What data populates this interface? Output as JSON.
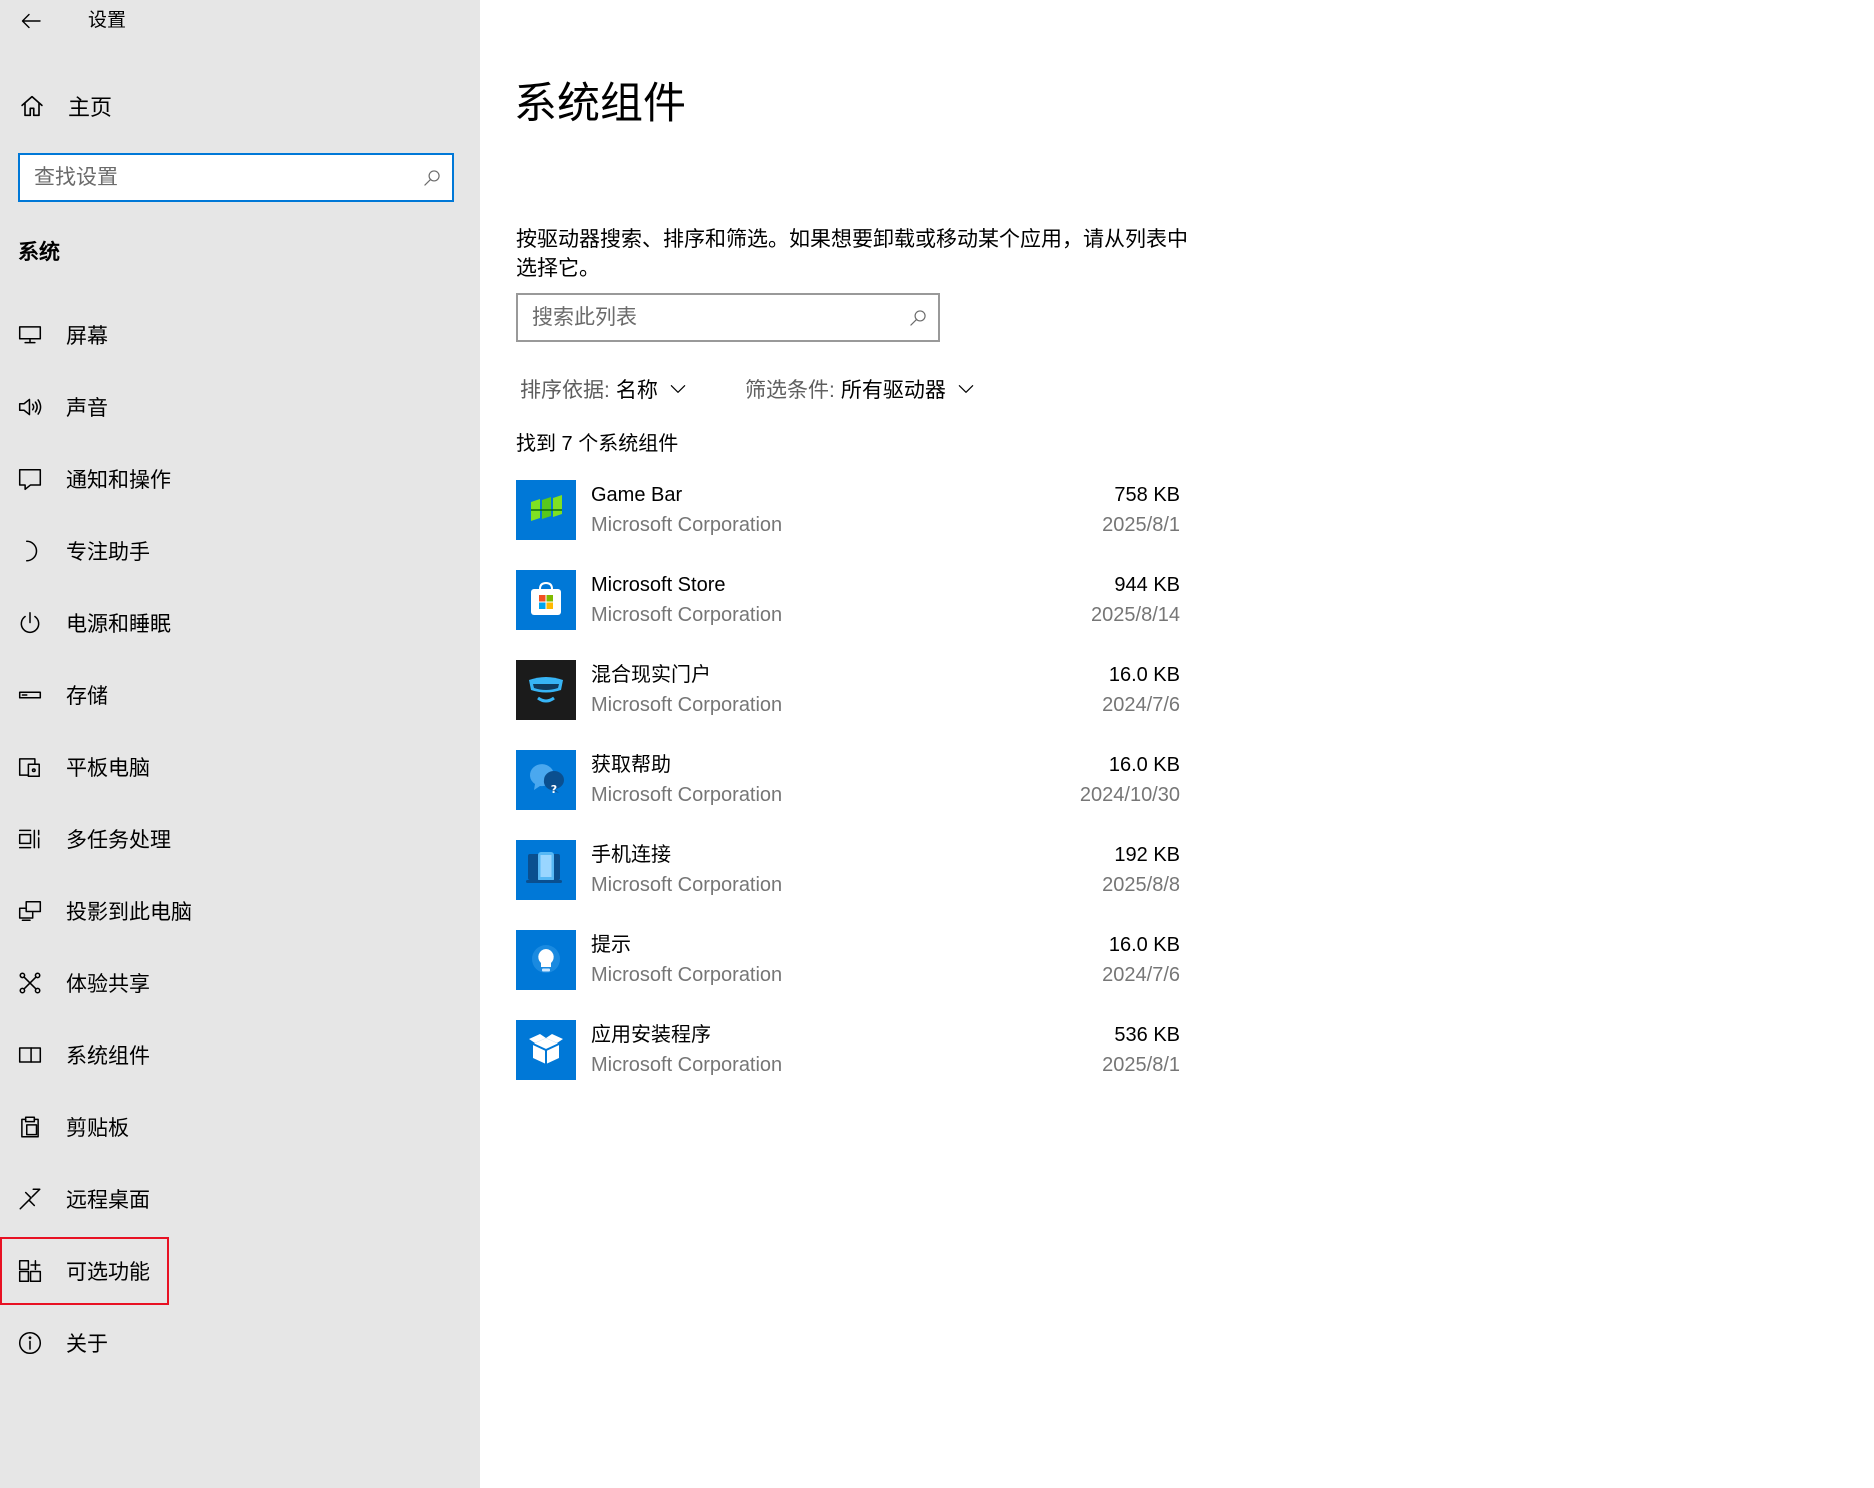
{
  "window": {
    "title": "设置"
  },
  "colors": {
    "accent": "#0078d7",
    "sidebar_bg": "#e6e6e6",
    "highlight": "#e81123",
    "secondary_text": "#767676"
  },
  "sidebar": {
    "home_label": "主页",
    "search_placeholder": "查找设置",
    "section_title": "系统",
    "items": [
      {
        "label": "屏幕",
        "icon": "display-icon"
      },
      {
        "label": "声音",
        "icon": "speaker-icon"
      },
      {
        "label": "通知和操作",
        "icon": "notification-icon"
      },
      {
        "label": "专注助手",
        "icon": "moon-icon"
      },
      {
        "label": "电源和睡眠",
        "icon": "power-icon"
      },
      {
        "label": "存储",
        "icon": "storage-icon"
      },
      {
        "label": "平板电脑",
        "icon": "tablet-icon"
      },
      {
        "label": "多任务处理",
        "icon": "multitasking-icon"
      },
      {
        "label": "投影到此电脑",
        "icon": "projection-icon"
      },
      {
        "label": "体验共享",
        "icon": "shared-experiences-icon"
      },
      {
        "label": "系统组件",
        "icon": "system-components-icon"
      },
      {
        "label": "剪贴板",
        "icon": "clipboard-icon"
      },
      {
        "label": "远程桌面",
        "icon": "remote-desktop-icon"
      },
      {
        "label": "可选功能",
        "icon": "optional-features-icon",
        "highlighted": true
      },
      {
        "label": "关于",
        "icon": "info-icon"
      }
    ]
  },
  "main": {
    "title": "系统组件",
    "description": "按驱动器搜索、排序和筛选。如果想要卸载或移动某个应用，请从列表中选择它。",
    "search_placeholder": "搜索此列表",
    "sort": {
      "label": "排序依据:",
      "value": "名称"
    },
    "filter": {
      "label": "筛选条件:",
      "value": "所有驱动器"
    },
    "count_text": "找到 7 个系统组件",
    "apps": [
      {
        "name": "Game Bar",
        "publisher": "Microsoft Corporation",
        "size": "758 KB",
        "date": "2025/8/1",
        "icon": "game-bar-icon"
      },
      {
        "name": "Microsoft Store",
        "publisher": "Microsoft Corporation",
        "size": "944 KB",
        "date": "2025/8/14",
        "icon": "store-icon"
      },
      {
        "name": "混合现实门户",
        "publisher": "Microsoft Corporation",
        "size": "16.0 KB",
        "date": "2024/7/6",
        "icon": "mixed-reality-icon"
      },
      {
        "name": "获取帮助",
        "publisher": "Microsoft Corporation",
        "size": "16.0 KB",
        "date": "2024/10/30",
        "icon": "get-help-icon"
      },
      {
        "name": "手机连接",
        "publisher": "Microsoft Corporation",
        "size": "192 KB",
        "date": "2025/8/8",
        "icon": "phone-link-icon"
      },
      {
        "name": "提示",
        "publisher": "Microsoft Corporation",
        "size": "16.0 KB",
        "date": "2024/7/6",
        "icon": "tips-icon"
      },
      {
        "name": "应用安装程序",
        "publisher": "Microsoft Corporation",
        "size": "536 KB",
        "date": "2025/8/1",
        "icon": "app-installer-icon"
      }
    ]
  }
}
